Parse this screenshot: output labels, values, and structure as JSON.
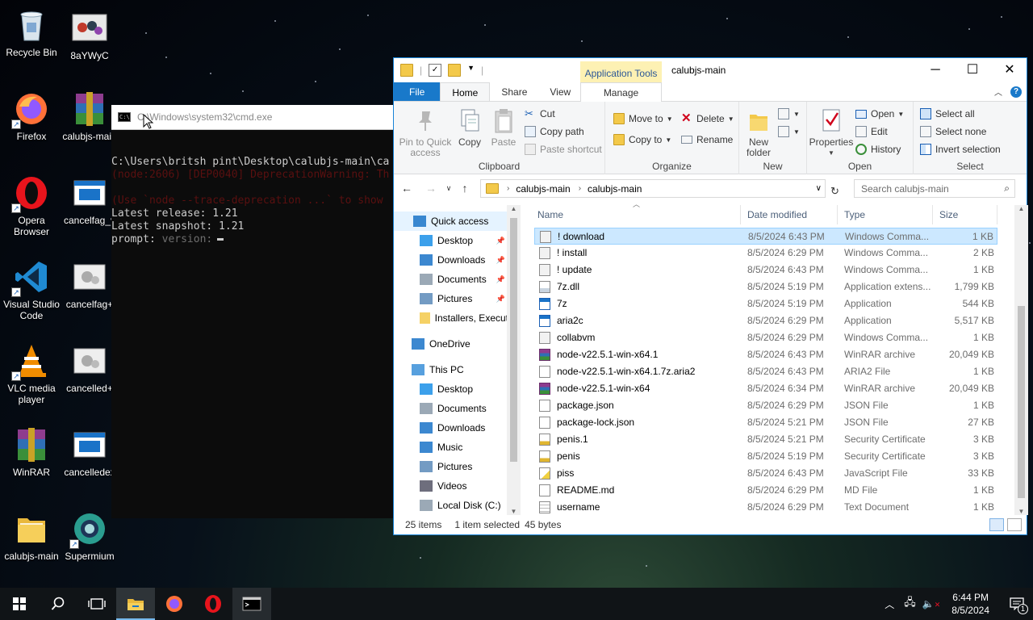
{
  "desktop": {
    "icons": [
      {
        "label": "Recycle Bin"
      },
      {
        "label": "8aYWyC"
      },
      {
        "label": "Firefox"
      },
      {
        "label": "calubjs-main"
      },
      {
        "label": "Opera Browser"
      },
      {
        "label": "cancelfag_v"
      },
      {
        "label": "Visual Studio Code"
      },
      {
        "label": "cancelfag+"
      },
      {
        "label": "VLC media player"
      },
      {
        "label": "cancelled+"
      },
      {
        "label": "WinRAR"
      },
      {
        "label": "cancelledex"
      },
      {
        "label": "calubjs-main"
      },
      {
        "label": "Supermium"
      }
    ]
  },
  "cmd": {
    "title": "C:\\Windows\\system32\\cmd.exe",
    "lines": [
      "C:\\Users\\britsh pint\\Desktop\\calubjs-main\\ca",
      "(node:2606) [DEP0040] DeprecationWarning: Th",
      "(Use `node --trace-deprecation ...` to show",
      "Latest release: 1.21",
      "Latest snapshot: 1.21"
    ],
    "prompt_label": "prompt:",
    "prompt_value": "version:"
  },
  "explorer": {
    "title": "calubjs-main",
    "context_tab": "Application Tools",
    "tabs": {
      "file": "File",
      "home": "Home",
      "share": "Share",
      "view": "View",
      "manage": "Manage"
    },
    "ribbon": {
      "clipboard": {
        "group": "Clipboard",
        "pin": "Pin to Quick access",
        "copy": "Copy",
        "paste": "Paste",
        "cut": "Cut",
        "copy_path": "Copy path",
        "paste_shortcut": "Paste shortcut"
      },
      "organize": {
        "group": "Organize",
        "move_to": "Move to",
        "copy_to": "Copy to",
        "delete": "Delete",
        "rename": "Rename"
      },
      "new": {
        "group": "New",
        "new_folder": "New folder"
      },
      "open": {
        "group": "Open",
        "properties": "Properties",
        "open": "Open",
        "edit": "Edit",
        "history": "History"
      },
      "select": {
        "group": "Select",
        "select_all": "Select all",
        "select_none": "Select none",
        "invert": "Invert selection"
      }
    },
    "address": {
      "crumbs": [
        "calubjs-main",
        "calubjs-main"
      ]
    },
    "search": {
      "placeholder": "Search calubjs-main"
    },
    "nav": {
      "items": [
        {
          "label": "Quick access",
          "pinned": false
        },
        {
          "label": "Desktop",
          "pinned": true
        },
        {
          "label": "Downloads",
          "pinned": true
        },
        {
          "label": "Documents",
          "pinned": true
        },
        {
          "label": "Pictures",
          "pinned": true
        },
        {
          "label": "Installers, Execut",
          "pinned": false
        },
        {
          "label": "OneDrive",
          "pinned": false
        },
        {
          "label": "This PC",
          "pinned": false
        },
        {
          "label": "Desktop",
          "pinned": false
        },
        {
          "label": "Documents",
          "pinned": false
        },
        {
          "label": "Downloads",
          "pinned": false
        },
        {
          "label": "Music",
          "pinned": false
        },
        {
          "label": "Pictures",
          "pinned": false
        },
        {
          "label": "Videos",
          "pinned": false
        },
        {
          "label": "Local Disk (C:)",
          "pinned": false
        }
      ]
    },
    "columns": {
      "name": "Name",
      "date": "Date modified",
      "type": "Type",
      "size": "Size"
    },
    "files": [
      {
        "name": "! download",
        "date": "8/5/2024 6:43 PM",
        "type": "Windows Comma...",
        "size": "1 KB",
        "icon": "cmd-file-icon"
      },
      {
        "name": "! install",
        "date": "8/5/2024 6:29 PM",
        "type": "Windows Comma...",
        "size": "2 KB",
        "icon": "cmd-file-icon"
      },
      {
        "name": "! update",
        "date": "8/5/2024 6:43 PM",
        "type": "Windows Comma...",
        "size": "1 KB",
        "icon": "cmd-file-icon"
      },
      {
        "name": "7z.dll",
        "date": "8/5/2024 5:19 PM",
        "type": "Application extens...",
        "size": "1,799 KB",
        "icon": "dll-file-icon"
      },
      {
        "name": "7z",
        "date": "8/5/2024 5:19 PM",
        "type": "Application",
        "size": "544 KB",
        "icon": "exe-file-icon"
      },
      {
        "name": "aria2c",
        "date": "8/5/2024 6:29 PM",
        "type": "Application",
        "size": "5,517 KB",
        "icon": "exe-file-icon"
      },
      {
        "name": "collabvm",
        "date": "8/5/2024 6:29 PM",
        "type": "Windows Comma...",
        "size": "1 KB",
        "icon": "cmd-file-icon"
      },
      {
        "name": "node-v22.5.1-win-x64.1",
        "date": "8/5/2024 6:43 PM",
        "type": "WinRAR archive",
        "size": "20,049 KB",
        "icon": "rar-file-icon"
      },
      {
        "name": "node-v22.5.1-win-x64.1.7z.aria2",
        "date": "8/5/2024 6:43 PM",
        "type": "ARIA2 File",
        "size": "1 KB",
        "icon": "blank-file-icon"
      },
      {
        "name": "node-v22.5.1-win-x64",
        "date": "8/5/2024 6:34 PM",
        "type": "WinRAR archive",
        "size": "20,049 KB",
        "icon": "rar-file-icon"
      },
      {
        "name": "package.json",
        "date": "8/5/2024 6:29 PM",
        "type": "JSON File",
        "size": "1 KB",
        "icon": "blank-file-icon"
      },
      {
        "name": "package-lock.json",
        "date": "8/5/2024 5:21 PM",
        "type": "JSON File",
        "size": "27 KB",
        "icon": "blank-file-icon"
      },
      {
        "name": "penis.1",
        "date": "8/5/2024 5:21 PM",
        "type": "Security Certificate",
        "size": "3 KB",
        "icon": "cert-file-icon"
      },
      {
        "name": "penis",
        "date": "8/5/2024 5:19 PM",
        "type": "Security Certificate",
        "size": "3 KB",
        "icon": "cert-file-icon"
      },
      {
        "name": "piss",
        "date": "8/5/2024 6:43 PM",
        "type": "JavaScript File",
        "size": "33 KB",
        "icon": "js-file-icon"
      },
      {
        "name": "README.md",
        "date": "8/5/2024 6:29 PM",
        "type": "MD File",
        "size": "1 KB",
        "icon": "blank-file-icon"
      },
      {
        "name": "username",
        "date": "8/5/2024 6:29 PM",
        "type": "Text Document",
        "size": "1 KB",
        "icon": "txt-file-icon"
      }
    ],
    "status": {
      "count": "25 items",
      "selected": "1 item selected",
      "bytes": "45 bytes"
    }
  },
  "taskbar": {
    "time": "6:44 PM",
    "date": "8/5/2024",
    "notification_count": "1"
  }
}
